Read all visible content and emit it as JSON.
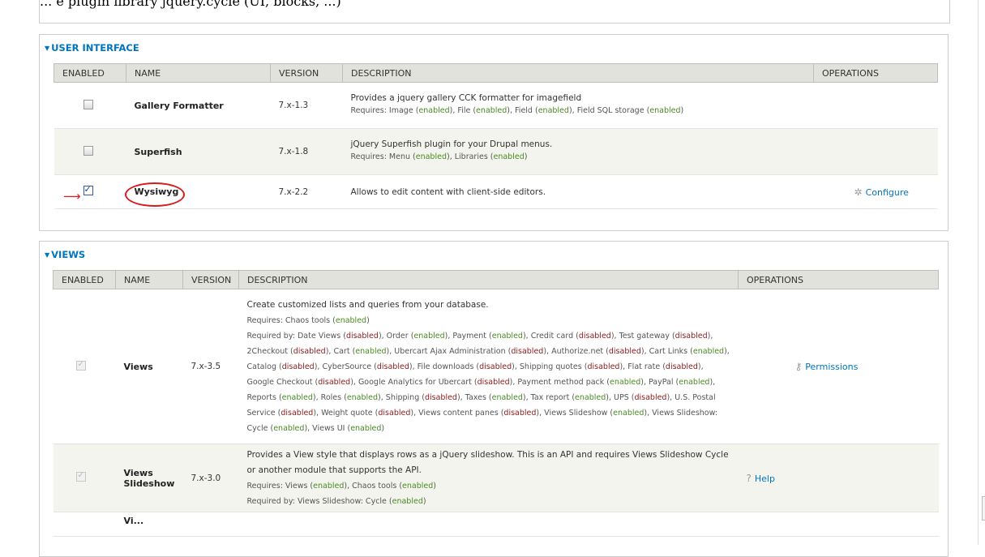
{
  "top_fragment": "... e plugin library jquery.cycle (UI, blocks, ...)",
  "user_interface": {
    "legend": "USER INTERFACE",
    "columns": [
      "ENABLED",
      "NAME",
      "VERSION",
      "DESCRIPTION",
      "OPERATIONS"
    ],
    "rows": [
      {
        "name": "Gallery Formatter",
        "version": "7.x-1.3",
        "description": "Provides a jquery gallery CCK formatter for imagefield",
        "requires_prefix": "Requires: ",
        "requires": [
          [
            "Image",
            "enabled"
          ],
          [
            "File",
            "enabled"
          ],
          [
            "Field",
            "enabled"
          ],
          [
            "Field SQL storage",
            "enabled"
          ]
        ],
        "checked": false
      },
      {
        "name": "Superfish",
        "version": "7.x-1.8",
        "description": "jQuery Superfish plugin for your Drupal menus.",
        "requires_prefix": "Requires: ",
        "requires": [
          [
            "Menu",
            "enabled"
          ],
          [
            "Libraries",
            "enabled"
          ]
        ],
        "checked": false
      },
      {
        "name": "Wysiwyg",
        "version": "7.x-2.2",
        "description": "Allows to edit content with client-side editors.",
        "operation": "Configure",
        "operation_icon": "gear-icon",
        "checked": true
      }
    ]
  },
  "views": {
    "legend": "VIEWS",
    "columns": [
      "ENABLED",
      "NAME",
      "VERSION",
      "DESCRIPTION",
      "OPERATIONS"
    ],
    "rows": [
      {
        "name": "Views",
        "version": "7.x-3.5",
        "description": "Create customized lists and queries from your database.",
        "requires_line": "Requires: Chaos tools (enabled)",
        "required_by": "Required by: Date Views (disabled), Order (enabled), Payment (enabled), Credit card (disabled), Test gateway (disabled), 2Checkout (disabled), Cart (enabled), Ubercart Ajax Administration (disabled), Authorize.net (disabled), Cart Links (enabled), Catalog (disabled), CyberSource (disabled), File downloads (disabled), Shipping quotes (disabled), Flat rate (disabled), Google Checkout (disabled), Google Analytics for Ubercart (disabled), Payment method pack (enabled), PayPal (enabled), Reports (enabled), Roles (enabled), Shipping (disabled), Taxes (enabled), Tax report (enabled), UPS (disabled), U.S. Postal Service (disabled), Weight quote (disabled), Views content panes (disabled), Views Slideshow (enabled), Views Slideshow: Cycle (enabled), Views UI (enabled)",
        "operation": "Permissions",
        "operation_icon": "key-icon",
        "checked": true
      },
      {
        "name": "Views Slideshow",
        "version": "7.x-3.0",
        "description": "Provides a View style that displays rows as a jQuery slideshow. This is an API and requires Views Slideshow Cycle or another module that supports the API.",
        "requires_line": "Requires: Views (enabled), Chaos tools (enabled)",
        "required_by": "Required by: Views Slideshow: Cycle (enabled)",
        "operation": "Help",
        "operation_icon": "help-icon",
        "checked": true
      },
      {
        "name": "Vi...",
        "partial": true
      }
    ]
  },
  "colors": {
    "link": "#0074bd",
    "enabled": "#4a8a23",
    "disabled": "#8b1a1a",
    "header_bg": "#e1e2dc",
    "annotation": "#e31b1b"
  }
}
